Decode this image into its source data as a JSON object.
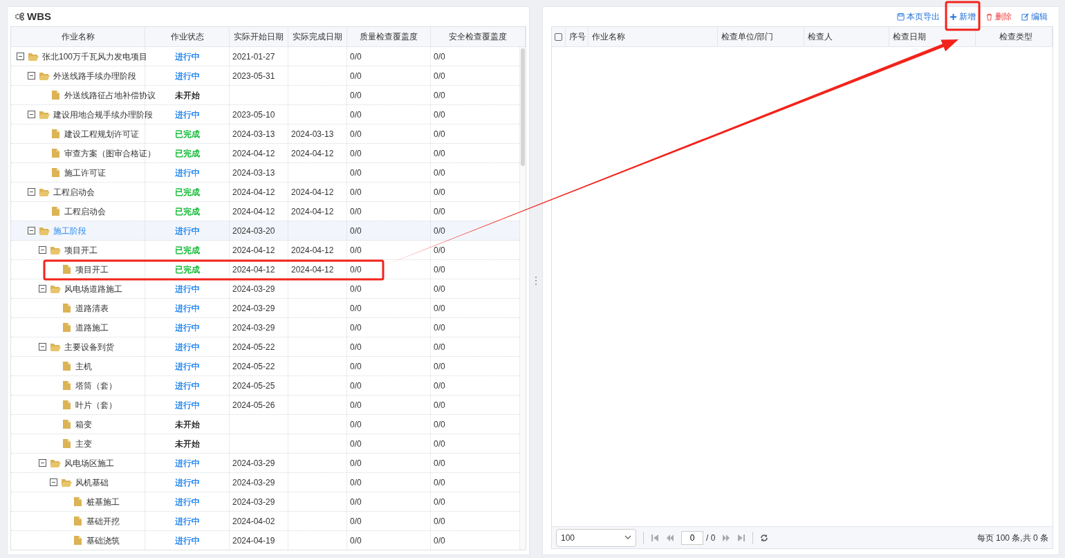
{
  "wbs_panel": {
    "title": "WBS",
    "columns": [
      "作业名称",
      "作业状态",
      "实际开始日期",
      "实际完成日期",
      "质量检查覆盖度",
      "安全检查覆盖度"
    ],
    "tree": [
      {
        "kind": "folder",
        "expanded": true,
        "selected": false,
        "name": "张北100万千瓦风力发电项目",
        "status": {
          "text": "进行中",
          "color": "#2d8cf0"
        },
        "start": "2021-01-27",
        "quality": "0/0",
        "safety": "0/0",
        "children": [
          {
            "kind": "folder",
            "expanded": true,
            "selected": false,
            "name": "外送线路手续办理阶段",
            "status": {
              "text": "进行中",
              "color": "#2d8cf0"
            },
            "start": "2023-05-31",
            "quality": "0/0",
            "safety": "0/0",
            "children": [
              {
                "kind": "file",
                "selected": false,
                "name": "外送线路征占地补偿协议",
                "status": {
                  "text": "未开始",
                  "color": "#333333"
                },
                "quality": "0/0",
                "safety": "0/0"
              }
            ]
          },
          {
            "kind": "folder",
            "expanded": true,
            "selected": false,
            "name": "建设用地合规手续办理阶段",
            "status": {
              "text": "进行中",
              "color": "#2d8cf0"
            },
            "start": "2023-05-10",
            "quality": "0/0",
            "safety": "0/0",
            "children": [
              {
                "kind": "file",
                "selected": false,
                "name": "建设工程规划许可证",
                "status": {
                  "text": "已完成",
                  "color": "#19be3b"
                },
                "start": "2024-03-13",
                "end": "2024-03-13",
                "quality": "0/0",
                "safety": "0/0"
              },
              {
                "kind": "file",
                "selected": false,
                "name": "审查方案（图审合格证）",
                "status": {
                  "text": "已完成",
                  "color": "#19be3b"
                },
                "start": "2024-04-12",
                "end": "2024-04-12",
                "quality": "0/0",
                "safety": "0/0"
              },
              {
                "kind": "file",
                "selected": false,
                "name": "施工许可证",
                "status": {
                  "text": "进行中",
                  "color": "#2d8cf0"
                },
                "start": "2024-03-13",
                "quality": "0/0",
                "safety": "0/0"
              }
            ]
          },
          {
            "kind": "folder",
            "expanded": true,
            "selected": false,
            "name": "工程启动会",
            "status": {
              "text": "已完成",
              "color": "#19be3b"
            },
            "start": "2024-04-12",
            "end": "2024-04-12",
            "quality": "0/0",
            "safety": "0/0",
            "children": [
              {
                "kind": "file",
                "selected": false,
                "name": "工程启动会",
                "status": {
                  "text": "已完成",
                  "color": "#19be3b"
                },
                "start": "2024-04-12",
                "end": "2024-04-12",
                "quality": "0/0",
                "safety": "0/0"
              }
            ]
          },
          {
            "kind": "folder",
            "expanded": true,
            "selected": true,
            "name": "施工阶段",
            "status": {
              "text": "进行中",
              "color": "#2d8cf0"
            },
            "start": "2024-03-20",
            "quality": "0/0",
            "safety": "0/0",
            "children": [
              {
                "kind": "folder",
                "expanded": true,
                "selected": false,
                "name": "项目开工",
                "status": {
                  "text": "已完成",
                  "color": "#19be3b"
                },
                "start": "2024-04-12",
                "end": "2024-04-12",
                "quality": "0/0",
                "safety": "0/0",
                "children": [
                  {
                    "kind": "file",
                    "selected": false,
                    "highlighted": true,
                    "name": "项目开工",
                    "status": {
                      "text": "已完成",
                      "color": "#19be3b"
                    },
                    "start": "2024-04-12",
                    "end": "2024-04-12",
                    "quality": "0/0",
                    "safety": "0/0"
                  }
                ]
              },
              {
                "kind": "folder",
                "expanded": true,
                "selected": false,
                "name": "风电场道路施工",
                "status": {
                  "text": "进行中",
                  "color": "#2d8cf0"
                },
                "start": "2024-03-29",
                "quality": "0/0",
                "safety": "0/0",
                "children": [
                  {
                    "kind": "file",
                    "selected": false,
                    "name": "道路清表",
                    "status": {
                      "text": "进行中",
                      "color": "#2d8cf0"
                    },
                    "start": "2024-03-29",
                    "quality": "0/0",
                    "safety": "0/0"
                  },
                  {
                    "kind": "file",
                    "selected": false,
                    "name": "道路施工",
                    "status": {
                      "text": "进行中",
                      "color": "#2d8cf0"
                    },
                    "start": "2024-03-29",
                    "quality": "0/0",
                    "safety": "0/0"
                  }
                ]
              },
              {
                "kind": "folder",
                "expanded": true,
                "selected": false,
                "name": "主要设备到货",
                "status": {
                  "text": "进行中",
                  "color": "#2d8cf0"
                },
                "start": "2024-05-22",
                "quality": "0/0",
                "safety": "0/0",
                "children": [
                  {
                    "kind": "file",
                    "selected": false,
                    "name": "主机",
                    "status": {
                      "text": "进行中",
                      "color": "#2d8cf0"
                    },
                    "start": "2024-05-22",
                    "quality": "0/0",
                    "safety": "0/0"
                  },
                  {
                    "kind": "file",
                    "selected": false,
                    "name": "塔筒（套）",
                    "status": {
                      "text": "进行中",
                      "color": "#2d8cf0"
                    },
                    "start": "2024-05-25",
                    "quality": "0/0",
                    "safety": "0/0"
                  },
                  {
                    "kind": "file",
                    "selected": false,
                    "name": "叶片（套）",
                    "status": {
                      "text": "进行中",
                      "color": "#2d8cf0"
                    },
                    "start": "2024-05-26",
                    "quality": "0/0",
                    "safety": "0/0"
                  },
                  {
                    "kind": "file",
                    "selected": false,
                    "name": "箱变",
                    "status": {
                      "text": "未开始",
                      "color": "#333333"
                    },
                    "quality": "0/0",
                    "safety": "0/0"
                  },
                  {
                    "kind": "file",
                    "selected": false,
                    "name": "主变",
                    "status": {
                      "text": "未开始",
                      "color": "#333333"
                    },
                    "quality": "0/0",
                    "safety": "0/0"
                  }
                ]
              },
              {
                "kind": "folder",
                "expanded": true,
                "selected": false,
                "name": "风电场区施工",
                "status": {
                  "text": "进行中",
                  "color": "#2d8cf0"
                },
                "start": "2024-03-29",
                "quality": "0/0",
                "safety": "0/0",
                "children": [
                  {
                    "kind": "folder",
                    "expanded": true,
                    "selected": false,
                    "name": "风机基础",
                    "status": {
                      "text": "进行中",
                      "color": "#2d8cf0"
                    },
                    "start": "2024-03-29",
                    "quality": "0/0",
                    "safety": "0/0",
                    "children": [
                      {
                        "kind": "file",
                        "selected": false,
                        "name": "桩基施工",
                        "status": {
                          "text": "进行中",
                          "color": "#2d8cf0"
                        },
                        "start": "2024-03-29",
                        "quality": "0/0",
                        "safety": "0/0"
                      },
                      {
                        "kind": "file",
                        "selected": false,
                        "name": "基础开挖",
                        "status": {
                          "text": "进行中",
                          "color": "#2d8cf0"
                        },
                        "start": "2024-04-02",
                        "quality": "0/0",
                        "safety": "0/0"
                      },
                      {
                        "kind": "file",
                        "selected": false,
                        "name": "基础浇筑",
                        "status": {
                          "text": "进行中",
                          "color": "#2d8cf0"
                        },
                        "start": "2024-04-19",
                        "quality": "0/0",
                        "safety": "0/0"
                      }
                    ]
                  }
                ]
              }
            ]
          }
        ]
      }
    ]
  },
  "inspection_panel": {
    "toolbar": [
      {
        "kind": "export",
        "label": "本页导出",
        "highlighted": false
      },
      {
        "kind": "add",
        "label": "新增",
        "highlighted": true
      },
      {
        "kind": "delete",
        "label": "删除",
        "highlighted": false
      },
      {
        "kind": "edit",
        "label": "编辑",
        "highlighted": false
      }
    ],
    "select_all_checked": false,
    "columns": [
      "序号",
      "作业名称",
      "检查单位/部门",
      "检查人",
      "检查日期",
      "检查类型"
    ],
    "pager": {
      "page_size": "100",
      "page": "0",
      "total_pages": "/ 0",
      "summary": "每页 100 条,共 0 条"
    }
  }
}
